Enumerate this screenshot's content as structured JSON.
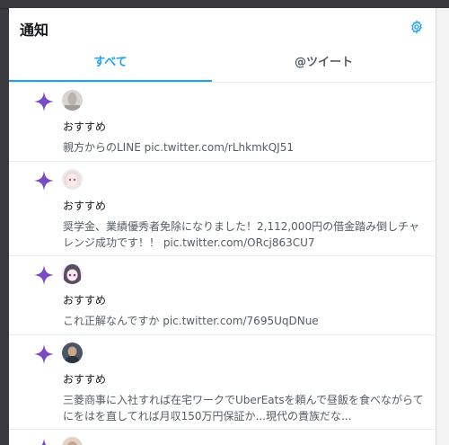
{
  "header": {
    "title": "通知",
    "settings_icon": "gear-icon"
  },
  "tabs": [
    {
      "label": "すべて",
      "active": true
    },
    {
      "label": "@ツイート",
      "active": false
    }
  ],
  "colors": {
    "accent": "#1da1f2",
    "sparkle": "#794bc4",
    "text_secondary": "#555c63"
  },
  "notifications": [
    {
      "icon": "sparkle-icon",
      "label": "おすすめ",
      "text": "親方からのLINE pic.twitter.com/rLhkmkQJ51"
    },
    {
      "icon": "sparkle-icon",
      "label": "おすすめ",
      "text": "奨学金、業績優秀者免除になりました！2,112,000円の借金踏み倒しチャレンジ成功です！！ pic.twitter.com/ORcj863CU7"
    },
    {
      "icon": "sparkle-icon",
      "label": "おすすめ",
      "text": "これ正解なんですか pic.twitter.com/7695UqDNue"
    },
    {
      "icon": "sparkle-icon",
      "label": "おすすめ",
      "text": "三菱商事に入社すれば在宅ワークでUberEatsを頼んで昼飯を食べながらてにをはを直してれば月収150万円保証か...現代の貴族だな..."
    },
    {
      "icon": "sparkle-icon"
    }
  ]
}
